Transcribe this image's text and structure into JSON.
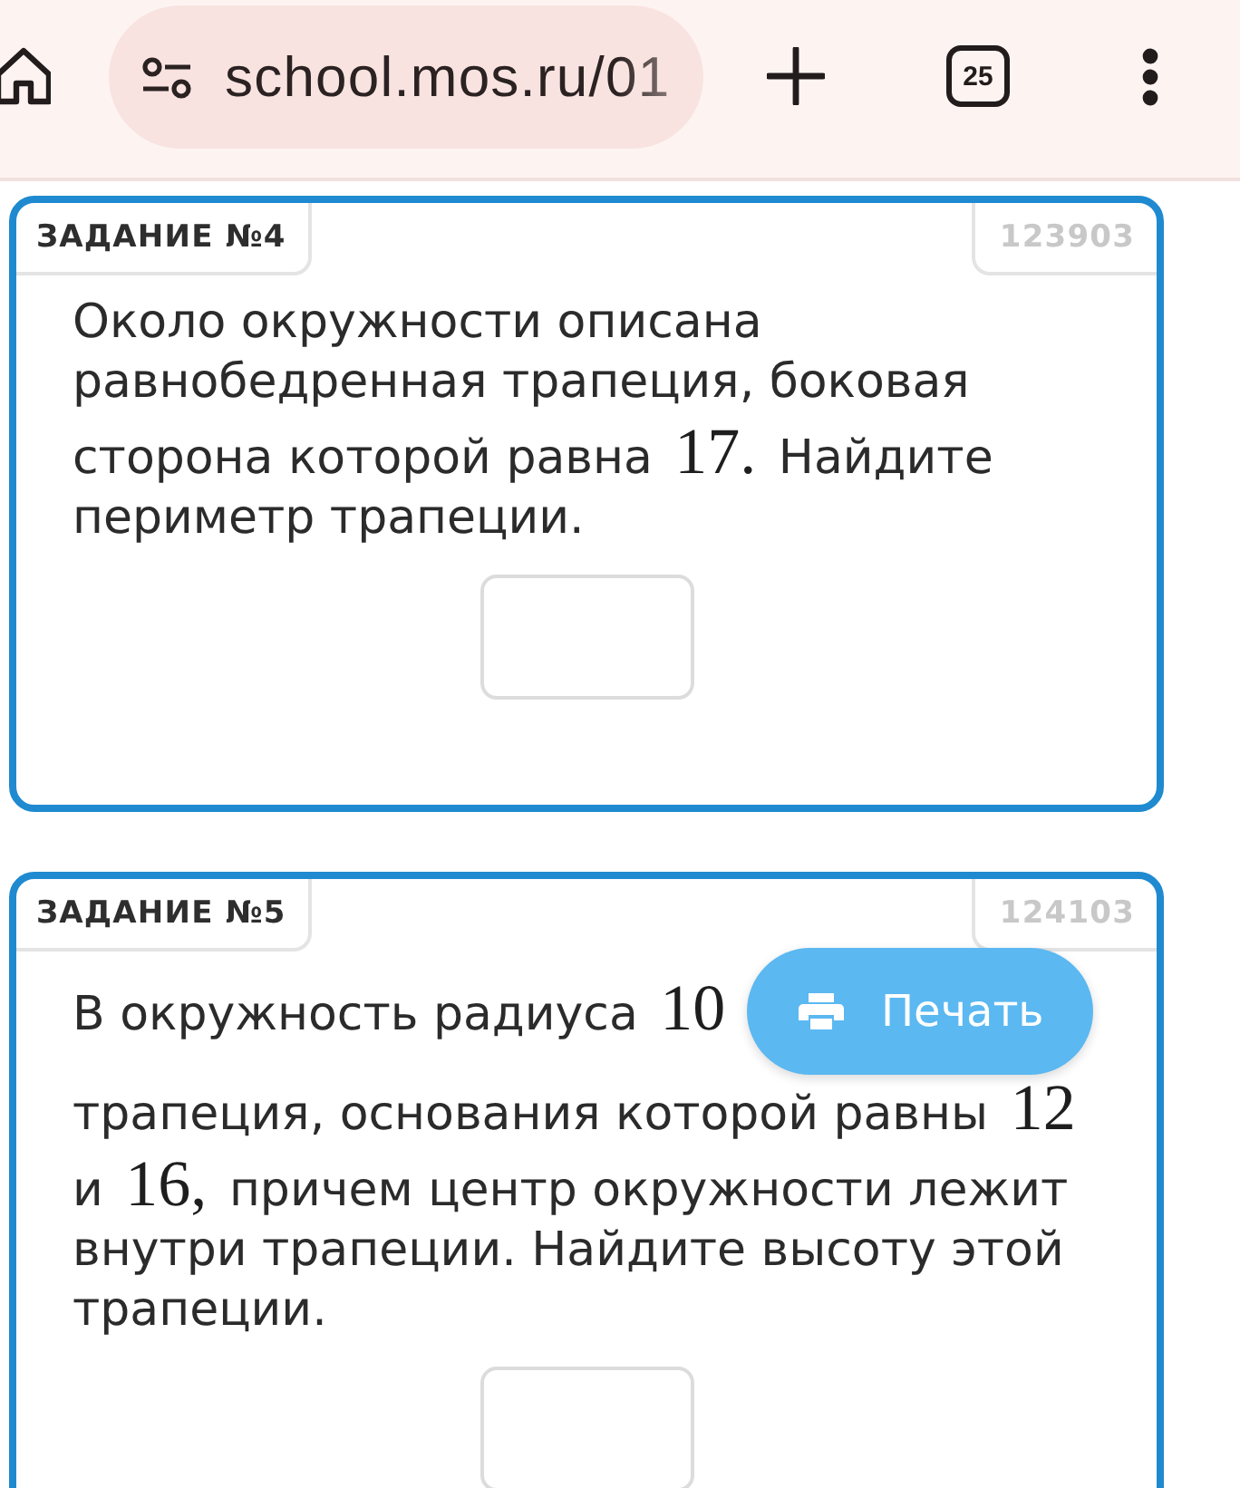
{
  "browser": {
    "url": "school.mos.ru/01",
    "tab_count": "25"
  },
  "tasks": [
    {
      "title": "ЗАДАНИЕ №4",
      "number": "123903",
      "text": [
        [
          {
            "kind": "text",
            "text": "Около окружности описана равнобедренная трапеция, боковая сторона которой равна"
          },
          {
            "kind": "math",
            "text": "17."
          },
          {
            "kind": "text",
            "text": "Найдите периметр трапеции."
          }
        ]
      ]
    },
    {
      "title": "ЗАДАНИЕ №5",
      "number": "124103",
      "text": [
        [
          {
            "kind": "text",
            "text": "В окружность радиуса"
          },
          {
            "kind": "math",
            "text": "10"
          }
        ],
        [
          {
            "kind": "text",
            "text": "трапеция, основания которой равны"
          },
          {
            "kind": "math",
            "text": "12"
          },
          {
            "kind": "text",
            "text": "и"
          },
          {
            "kind": "math",
            "text": "16,"
          },
          {
            "kind": "text",
            "text": "причем центр окружности лежит внутри трапеции. Найдите высоту этой трапеции."
          }
        ]
      ]
    }
  ],
  "print_button": {
    "label": "Печать"
  }
}
